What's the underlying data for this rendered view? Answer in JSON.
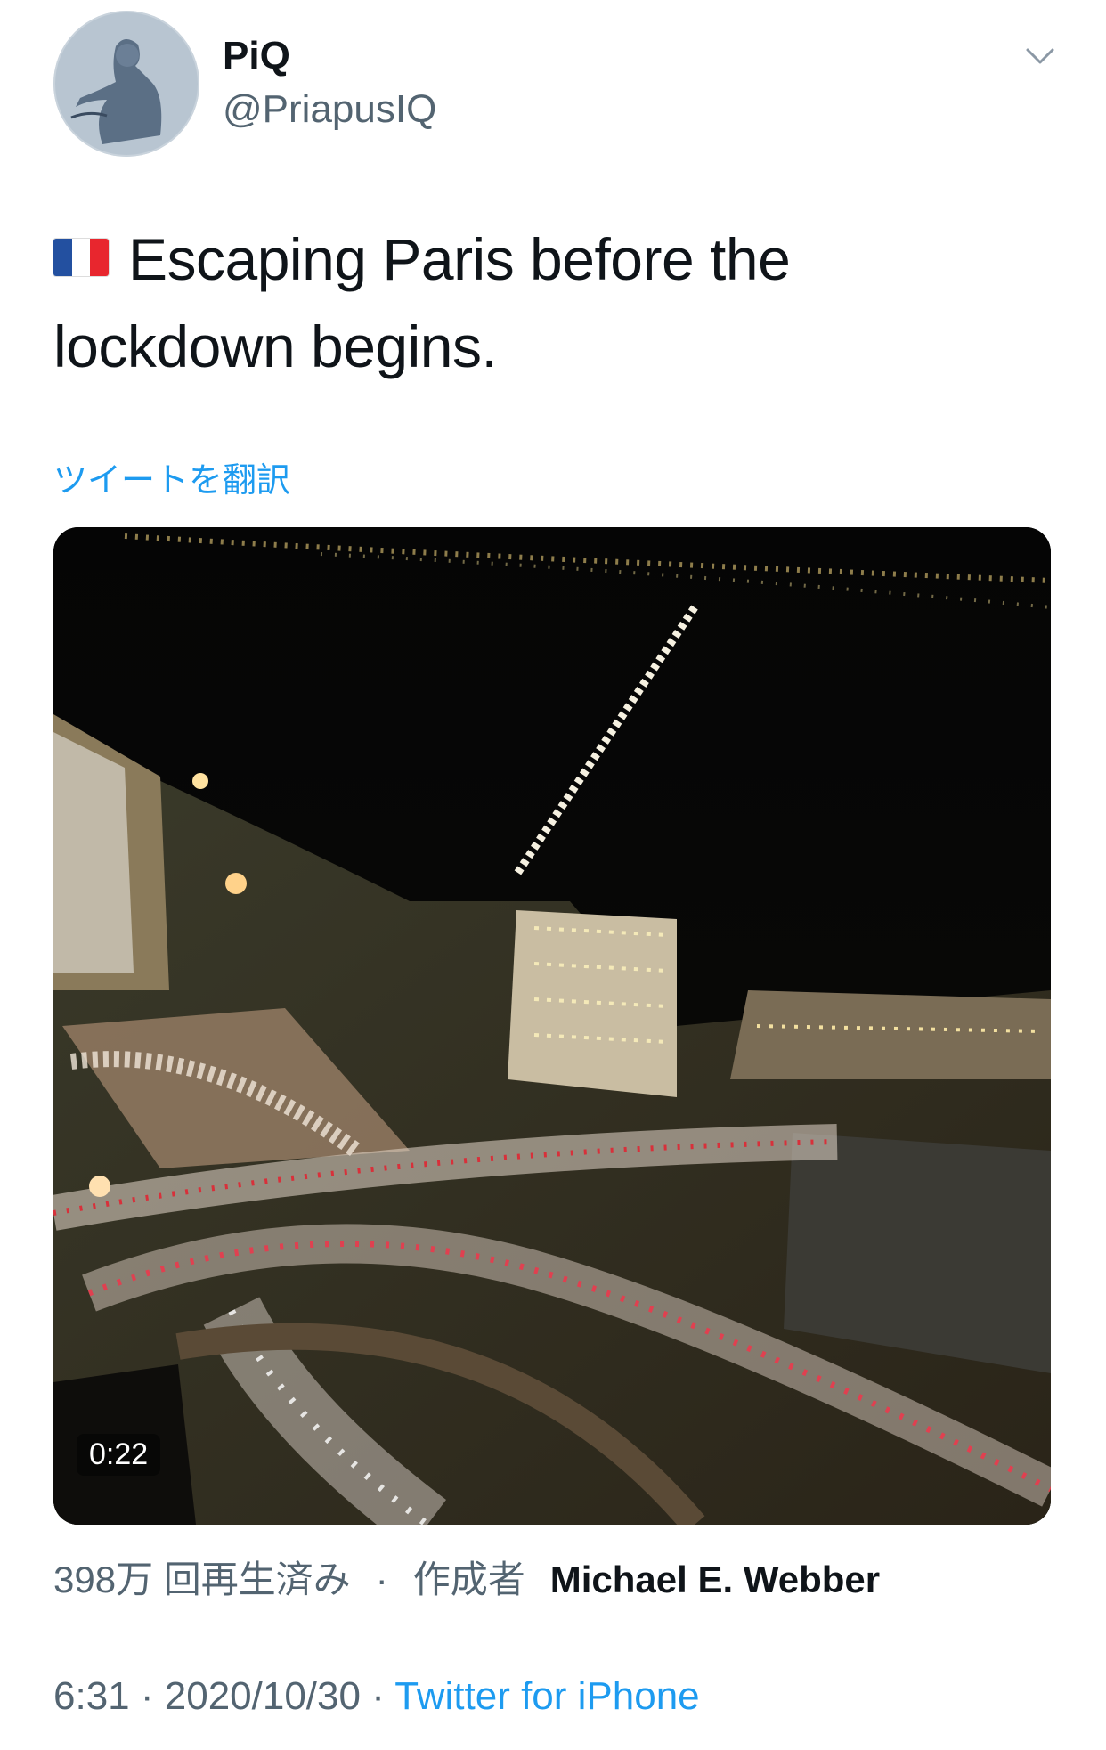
{
  "author": {
    "display_name": "PiQ",
    "handle": "@PriapusIQ"
  },
  "tweet": {
    "flag_icon": "france-flag-icon",
    "text_line1": "Escaping Paris before the",
    "text_line2": "lockdown begins.",
    "translate_label": "ツイートを翻訳"
  },
  "media": {
    "duration": "0:22"
  },
  "meta": {
    "views": "398万 回再生済み",
    "separator": "·",
    "creator_label": "作成者",
    "creator_name": "Michael E. Webber"
  },
  "footer": {
    "time": "6:31",
    "sep1": " · ",
    "date": "2020/10/30",
    "sep2": " · ",
    "source": "Twitter for iPhone"
  },
  "colors": {
    "accent": "#1d9bf0",
    "secondary_text": "#536471",
    "primary_text": "#0f1419"
  }
}
